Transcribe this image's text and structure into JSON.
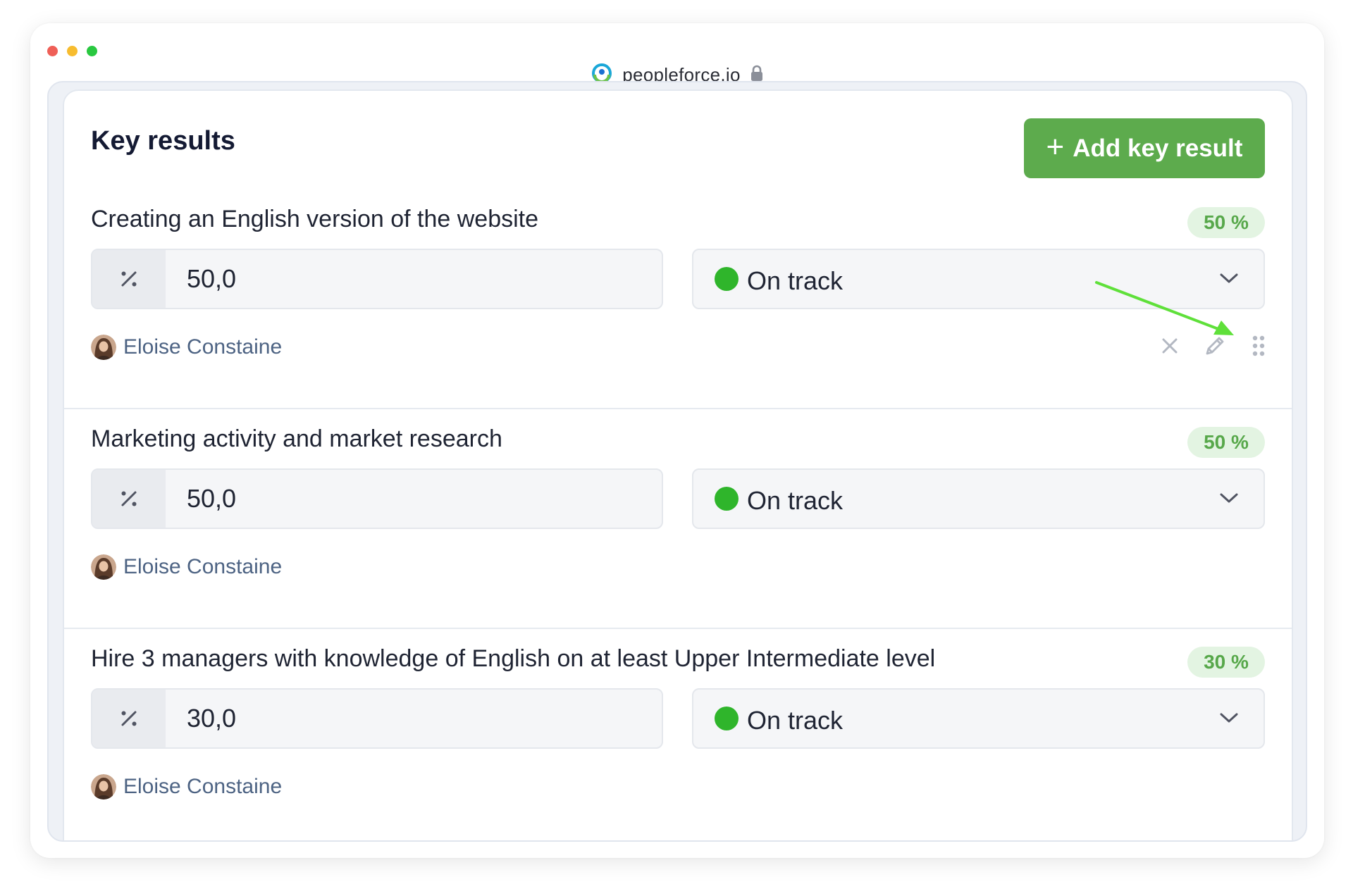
{
  "browser": {
    "url": "peopleforce.io",
    "dot_colors": [
      "#ef5f57",
      "#f7bc2f",
      "#29c840"
    ]
  },
  "panel": {
    "title": "Key results",
    "add_button_label": "Add key result"
  },
  "key_results": [
    {
      "title": "Creating an English version of the website",
      "badge": "50 %",
      "value": "50,0",
      "status": "On track",
      "owner": "Eloise Constaine",
      "show_actions": true
    },
    {
      "title": "Marketing activity and market research",
      "badge": "50 %",
      "value": "50,0",
      "status": "On track",
      "owner": "Eloise Constaine",
      "show_actions": false
    },
    {
      "title": "Hire 3 managers with knowledge of English on at least Upper Intermediate level",
      "badge": "30 %",
      "value": "30,0",
      "status": "On track",
      "owner": "Eloise Constaine",
      "show_actions": false
    }
  ],
  "icons": {
    "value_prefix": "percent-icon",
    "status_dot": "green-status-dot",
    "dropdown": "chevron-down-icon",
    "delete": "close-icon",
    "edit": "pencil-icon",
    "drag": "drag-handle-icon",
    "annotation": "green-arrow-annotation"
  },
  "colors": {
    "accent_green": "#5dab4d",
    "badge_text": "#57a84a",
    "badge_bg": "#e3f4e2",
    "status_green": "#2fb52b",
    "owner_text": "#4d6383",
    "annotation_arrow": "#5fe03a"
  }
}
